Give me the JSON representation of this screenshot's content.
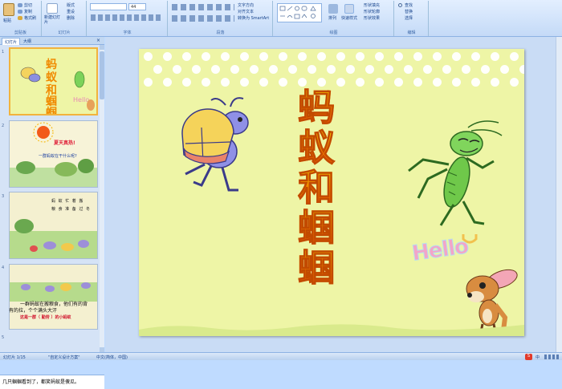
{
  "ribbon": {
    "groups": [
      {
        "label": "剪贴板",
        "buttons": [
          "粘贴",
          "剪切",
          "复制",
          "格式刷"
        ]
      },
      {
        "label": "幻灯片",
        "buttons": [
          "新建幻灯片",
          "版式",
          "重设",
          "删除"
        ]
      },
      {
        "label": "字体",
        "buttons": [
          "44"
        ]
      },
      {
        "label": "段落",
        "buttons": [
          "文字方向",
          "对齐文本",
          "转换为 SmartArt"
        ]
      },
      {
        "label": "绘图",
        "buttons": [
          "排列",
          "快速样式",
          "形状填充",
          "形状轮廓",
          "形状效果"
        ]
      },
      {
        "label": "编辑",
        "buttons": [
          "查找",
          "替换",
          "选择"
        ]
      }
    ]
  },
  "panel": {
    "tabs": [
      "幻灯片",
      "大纲"
    ],
    "thumbs": [
      {
        "num": "1",
        "text": ""
      },
      {
        "num": "2",
        "text": "夏天真热!",
        "text2": "一群蚂蚁在干什么呢?"
      },
      {
        "num": "3",
        "text": "蚂 蚁 忙 着 搬",
        "text2": "粮 食 准 备 过 冬"
      },
      {
        "num": "4",
        "text": "一群蚂蚁在搬粮食，他们有的背",
        "text2": "有的拉，个个满头大汗"
      },
      {
        "num": "5",
        "text": ""
      }
    ],
    "caption_line1": "一群蚂蚁在搬粮食，他们有的背",
    "caption_line2": "有的拉，个个满头大汗",
    "caption_line3": "这是一群（   勤劳   ）的小蚂蚁"
  },
  "slide": {
    "title_chars": [
      "蚂",
      "蚁",
      "和",
      "蝈",
      "蝈"
    ],
    "hello": "Hello"
  },
  "notes": {
    "text": "几只蝈蝈看到了，都笑蚂蚁是傻瓜。"
  },
  "status": {
    "slide_info": "幻灯片 1/15",
    "theme": "\"自定义设计方案\"",
    "language": "中文(简体，中国)",
    "ime": "中"
  }
}
